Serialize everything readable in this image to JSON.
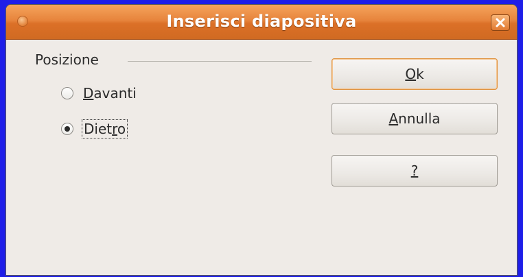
{
  "window": {
    "title": "Inserisci diapositiva",
    "close_icon": "close-icon",
    "accent": "#dc7027"
  },
  "position_group": {
    "label": "Posizione",
    "options": [
      {
        "first": "D",
        "rest": "avanti",
        "selected": false
      },
      {
        "pre": "Diet",
        "ul": "r",
        "post": "o",
        "selected": true
      }
    ]
  },
  "buttons": {
    "ok": {
      "ul": "O",
      "rest": "k"
    },
    "cancel": {
      "ul": "A",
      "rest": "nnulla"
    },
    "help": {
      "ul": "?",
      "rest": ""
    }
  }
}
